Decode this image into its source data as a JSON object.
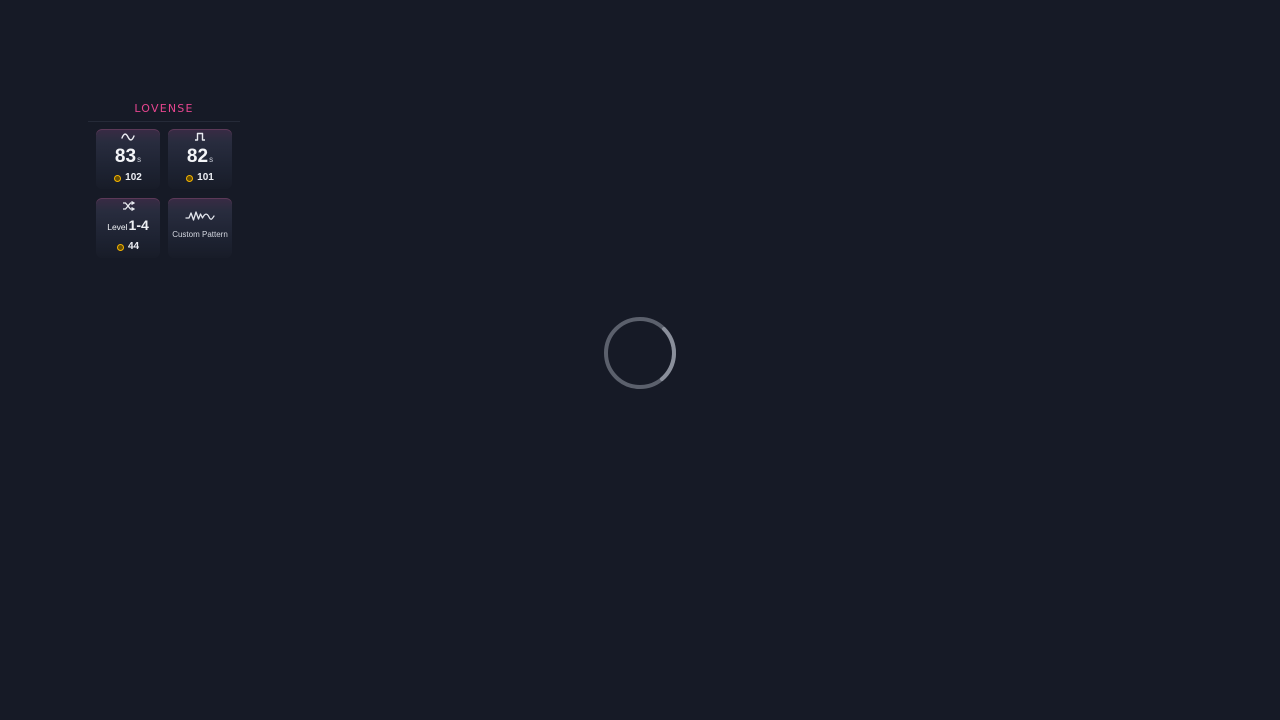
{
  "brand": {
    "name": "LOVENSE",
    "color": "#e6458f"
  },
  "tiles": [
    {
      "icon": "wave-icon",
      "value": "83",
      "unit": "s",
      "price": "102"
    },
    {
      "icon": "pulse-icon",
      "value": "82",
      "unit": "s",
      "price": "101"
    },
    {
      "icon": "random-icon",
      "level_word": "Level",
      "level_value": "1-4",
      "price": "44"
    },
    {
      "icon": "custom-pattern-icon",
      "label": "Custom Pattern"
    }
  ],
  "colors": {
    "background": "#161a26",
    "coin": "#f5b400",
    "spinner": "#8a8f9b"
  },
  "loading": {
    "icon": "loading-spinner"
  }
}
